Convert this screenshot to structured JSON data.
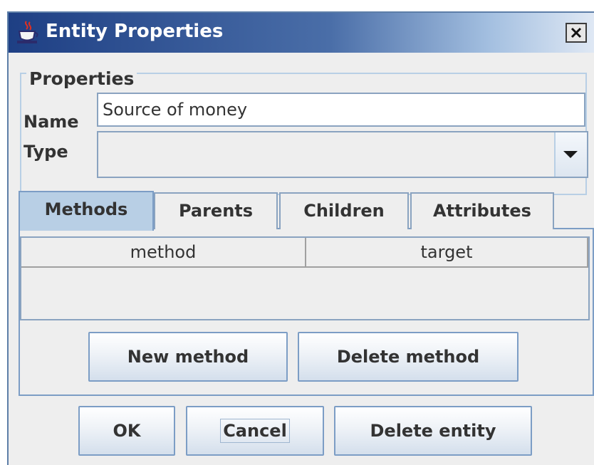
{
  "window": {
    "title": "Entity Properties",
    "close_label": "X"
  },
  "properties": {
    "group_title": "Properties",
    "name_label": "Name",
    "name_value": "Source of money",
    "type_label": "Type",
    "type_value": ""
  },
  "tabs": [
    {
      "label": "Methods",
      "active": true
    },
    {
      "label": "Parents",
      "active": false
    },
    {
      "label": "Children",
      "active": false
    },
    {
      "label": "Attributes",
      "active": false
    }
  ],
  "methods_table": {
    "columns": [
      "method",
      "target"
    ],
    "rows": []
  },
  "methods_buttons": {
    "new": "New method",
    "delete": "Delete method"
  },
  "dialog_buttons": {
    "ok": "OK",
    "cancel": "Cancel",
    "delete_entity": "Delete entity"
  },
  "icons": {
    "app": "java-coffee-cup-icon",
    "close": "close-icon",
    "dropdown": "chevron-down-icon"
  },
  "colors": {
    "titlebar_start": "#1e3f84",
    "titlebar_end": "#dfe8f4",
    "active_tab": "#b8cfe5",
    "border": "#7c9dc5"
  }
}
